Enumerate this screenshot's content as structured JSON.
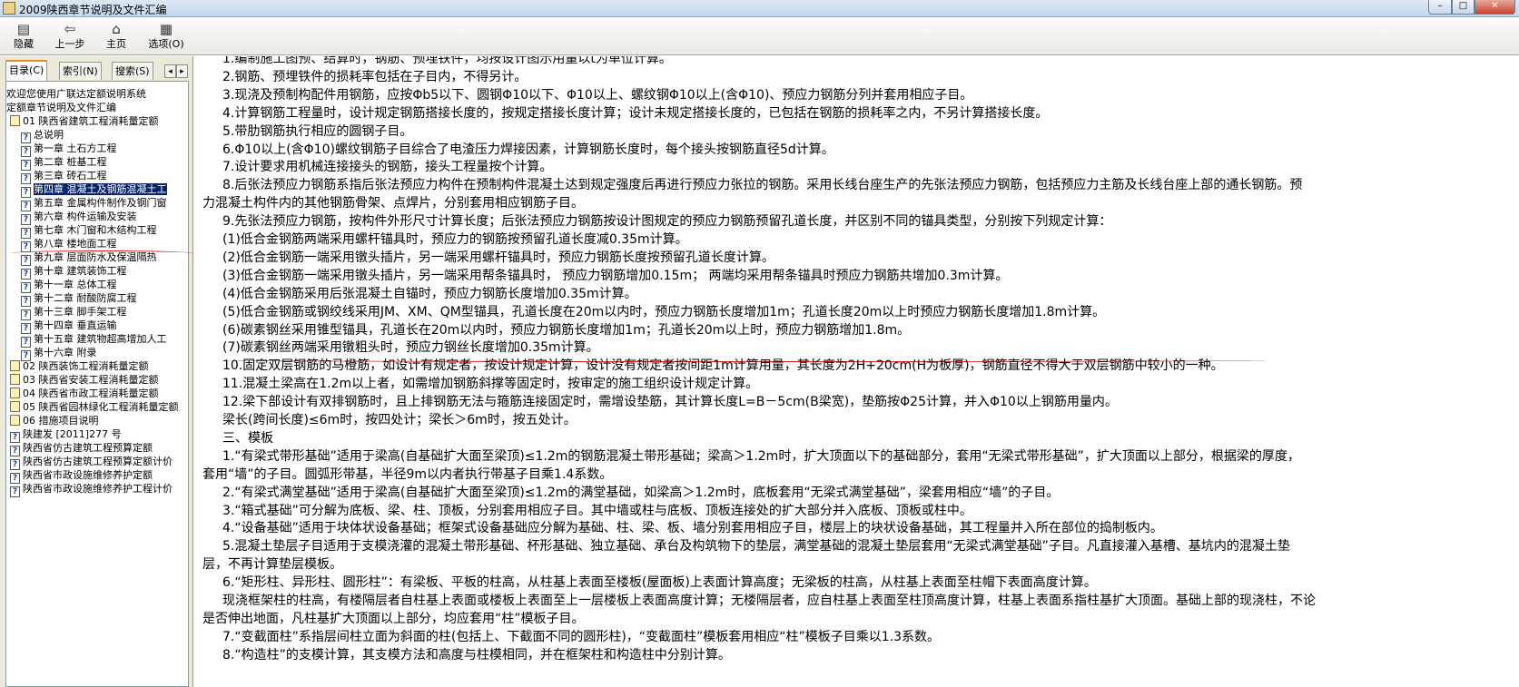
{
  "window": {
    "title": "2009陕西章节说明及文件汇编",
    "minimize_glyph": "–",
    "maximize_glyph": "□",
    "close_glyph": "✕"
  },
  "toolbar": {
    "buttons": [
      {
        "label": "隐藏",
        "icon": "hide-icon",
        "glyph": "▤"
      },
      {
        "label": "上一步",
        "icon": "back-arrow-icon",
        "glyph": "⇦"
      },
      {
        "label": "主页",
        "icon": "home-icon",
        "glyph": "⌂"
      },
      {
        "label": "选项(O)",
        "icon": "options-icon",
        "glyph": "▦"
      }
    ]
  },
  "nav_tabs": [
    "目录(C)",
    "索引(N)",
    "搜索(S)"
  ],
  "nav_arrows": [
    "◂",
    "▸"
  ],
  "tree": [
    {
      "label": "欢迎您使用广联达定额说明系统",
      "icon": "none"
    },
    {
      "label": "定额章节说明及文件汇编",
      "icon": "none"
    },
    {
      "label": "01 陕西省建筑工程消耗量定额",
      "icon": "book"
    },
    {
      "label": "总说明",
      "icon": "help"
    },
    {
      "label": "第一章 土石方工程",
      "icon": "help"
    },
    {
      "label": "第二章 桩基工程",
      "icon": "help"
    },
    {
      "label": "第三章 砖石工程",
      "icon": "help"
    },
    {
      "label": "第四章 混凝土及钢筋混凝土工",
      "icon": "help",
      "selected": true
    },
    {
      "label": "第五章 金属构件制作及钢门窗",
      "icon": "help"
    },
    {
      "label": "第六章 构件运输及安装",
      "icon": "help"
    },
    {
      "label": "第七章 木门窗和木结构工程",
      "icon": "help"
    },
    {
      "label": "第八章 楼地面工程",
      "icon": "help"
    },
    {
      "label": "第九章 层面防水及保温隔热",
      "icon": "help"
    },
    {
      "label": "第十章 建筑装饰工程",
      "icon": "help"
    },
    {
      "label": "第十一章 总体工程",
      "icon": "help"
    },
    {
      "label": "第十二章 耐酸防腐工程",
      "icon": "help"
    },
    {
      "label": "第十三章 脚手架工程",
      "icon": "help"
    },
    {
      "label": "第十四章 垂直运输",
      "icon": "help"
    },
    {
      "label": "第十五章 建筑物超高增加人工",
      "icon": "help"
    },
    {
      "label": "第十六章 附录",
      "icon": "help"
    },
    {
      "label": "02 陕西装饰工程消耗量定额",
      "icon": "book"
    },
    {
      "label": "03 陕西省安装工程消耗量定额",
      "icon": "book"
    },
    {
      "label": "04 陕西省市政工程消耗量定额",
      "icon": "book"
    },
    {
      "label": "05 陕西省园林绿化工程消耗量定额",
      "icon": "book"
    },
    {
      "label": "06 措施项目说明",
      "icon": "book"
    },
    {
      "label": "陕建发 [2011]277 号",
      "icon": "help"
    },
    {
      "label": "陕西省仿古建筑工程预算定额",
      "icon": "help"
    },
    {
      "label": "陕西省仿古建筑工程预算定额计价",
      "icon": "help"
    },
    {
      "label": "陕西省市政设施维修养护定额",
      "icon": "help"
    },
    {
      "label": "陕西省市政设施维修养护工程计价",
      "icon": "help"
    }
  ],
  "content_lines": [
    "1.编制施工图预、结算时，钢筋、预埋铁件，均按设计图示用量以t为单位计算。",
    "2.钢筋、预埋铁件的损耗率包括在子目内，不得另计。",
    "3.现浇及预制构配件用钢筋，应按Φb5以下、圆钢Φ10以下、Φ10以上、螺纹钢Φ10以上(含Φ10)、预应力钢筋分列并套用相应子目。",
    "4.计算钢筋工程量时，设计规定钢筋搭接长度的，按规定搭接长度计算；设计未规定搭接长度的，已包括在钢筋的损耗率之内，不另计算搭接长度。",
    "5.带肋钢筋执行相应的圆钢子目。",
    "6.Φ10以上(含Φ10)螺纹钢筋子目综合了电渣压力焊接因素，计算钢筋长度时，每个接头按钢筋直径5d计算。",
    "7.设计要求用机械连接接头的钢筋，接头工程量按个计算。",
    "8.后张法预应力钢筋系指后张法预应力构件在预制构件混凝土达到规定强度后再进行预应力张拉的钢筋。采用长线台座生产的先张法预应力钢筋，包括预应力主筋及长线台座上部的通长钢筋。预",
    "力混凝土构件内的其他钢筋骨架、点焊片，分别套用相应钢筋子目。",
    "9.先张法预应力钢筋，按构件外形尺寸计算长度；后张法预应力钢筋按设计图规定的预应力钢筋预留孔道长度，并区别不同的锚具类型，分别按下列规定计算：",
    "(1)低合金钢筋两端采用螺杆锚具时，预应力的钢筋按预留孔道长度减0.35m计算。",
    "(2)低合金钢筋一端采用镦头插片，另一端采用螺杆锚具时，预应力钢筋长度按预留孔道长度计算。",
    "(3)低合金钢筋一端采用镦头插片，另一端采用帮条锚具时， 预应力钢筋增加0.15m； 两端均采用帮条锚具时预应力钢筋共增加0.3m计算。",
    "(4)低合金钢筋采用后张混凝土自锚时，预应力钢筋长度增加0.35m计算。",
    "(5)低合金钢筋或钢绞线采用JM、XM、QM型锚具，孔道长度在20m以内时，预应力钢筋长度增加1m；孔道长度20m以上时预应力钢筋长度增加1.8m计算。",
    "(6)碳素钢丝采用锥型锚具，孔道长在20m以内时，预应力钢筋长度增加1m；孔道长20m以上时，预应力钢筋增加1.8m。",
    "(7)碳素钢丝两端采用镦粗头时，预应力钢丝长度增加0.35m计算。",
    "10.固定双层钢筋的马橙筋，如设计有规定者，按设计规定计算，设计没有规定者按间距1m计算用量，其长度为2H+20cm(H为板厚)，钢筋直径不得大于双层钢筋中较小的一种。",
    "11.混凝土梁高在1.2m以上者，如需增加钢筋斜撑等固定时，按审定的施工组织设计规定计算。",
    "12.梁下部设计有双排钢筋时，且上排钢筋无法与箍筋连接固定时，需增设垫筋，其计算长度L=B－5cm(B梁宽)，垫筋按Φ25计算，并入Φ10以上钢筋用量内。",
    "梁长(跨间长度)≤6m时，按四处计；梁长＞6m时，按五处计。",
    "三、模板",
    "1.“有梁式带形基础”适用于梁高(自基础扩大面至梁顶)≤1.2m的钢筋混凝土带形基础；梁高＞1.2m时，扩大顶面以下的基础部分，套用“无梁式带形基础”，扩大顶面以上部分，根据梁的厚度，",
    "套用“墙”的子目。圆弧形带基，半径9m以内者执行带基子目乘1.4系数。",
    "2.“有梁式满堂基础”适用于梁高(自基础扩大面至梁顶)≤1.2m的满堂基础，如梁高＞1.2m时，底板套用“无梁式满堂基础”，梁套用相应“墙”的子目。",
    "3.“箱式基础”可分解为底板、梁、柱、顶板，分别套用相应子目。其中墙或柱与底板、顶板连接处的扩大部分并入底板、顶板或柱中。",
    "4.“设备基础”适用于块体状设备基础；框架式设备基础应分解为基础、柱、梁、板、墙分别套用相应子目，楼层上的块状设备基础，其工程量并入所在部位的捣制板内。",
    "5.混凝土垫层子目适用于支模浇灌的混凝土带形基础、杯形基础、独立基础、承台及构筑物下的垫层，满堂基础的混凝土垫层套用“无梁式满堂基础”子目。凡直接灌入基槽、基坑内的混凝土垫",
    "层，不再计算垫层模板。",
    "6.“矩形柱、异形柱、圆形柱”：有梁板、平板的柱高，从柱基上表面至楼板(屋面板)上表面计算高度；无梁板的柱高，从柱基上表面至柱帽下表面高度计算。",
    "现浇框架柱的柱高，有楼隔层者自柱基上表面或楼板上表面至上一层楼板上表面高度计算；无楼隔层者，应自柱基上表面至柱顶高度计算，柱基上表面系指柱基扩大顶面。基础上部的现浇柱，不论",
    "是否伸出地面，凡柱基扩大顶面以上部分，均应套用“柱”模板子目。",
    "7.“变截面柱”系指层间柱立面为斜面的柱(包括上、下截面不同的圆形柱)，“变截面柱”模板套用相应“柱”模板子目乘以1.3系数。",
    "8.“构造柱”的支模计算，其支模方法和高度与柱模相同，并在框架柱和构造柱中分别计算。"
  ]
}
